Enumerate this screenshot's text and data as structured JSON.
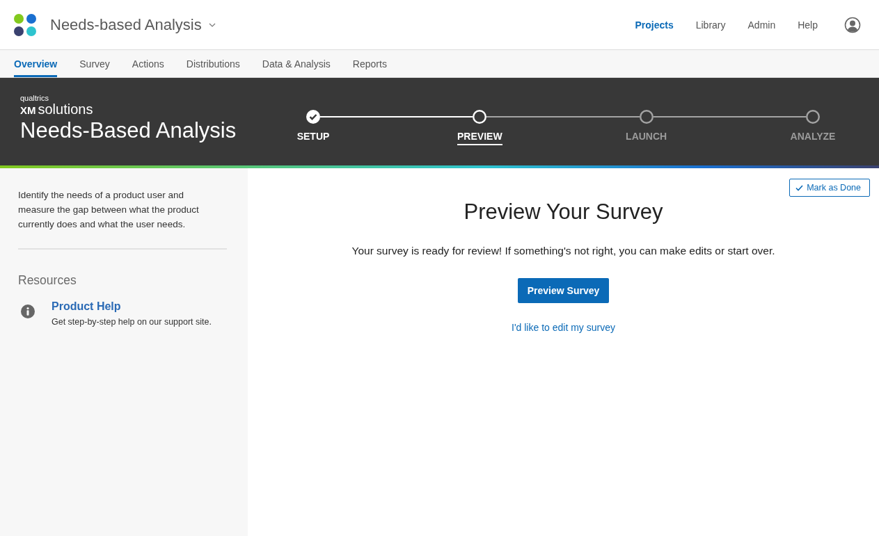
{
  "header": {
    "project_title": "Needs-based Analysis",
    "nav": [
      {
        "label": "Projects",
        "selected": true
      },
      {
        "label": "Library",
        "selected": false
      },
      {
        "label": "Admin",
        "selected": false
      },
      {
        "label": "Help",
        "selected": false
      }
    ]
  },
  "tabs": [
    {
      "label": "Overview",
      "selected": true
    },
    {
      "label": "Survey",
      "selected": false
    },
    {
      "label": "Actions",
      "selected": false
    },
    {
      "label": "Distributions",
      "selected": false
    },
    {
      "label": "Data & Analysis",
      "selected": false
    },
    {
      "label": "Reports",
      "selected": false
    }
  ],
  "banner": {
    "brand_small": "qualtrics",
    "brand_xm": "XM",
    "brand_solutions": "solutions",
    "title": "Needs-Based Analysis",
    "steps": [
      {
        "label": "SETUP",
        "completed": true,
        "reached": true,
        "selected": false
      },
      {
        "label": "PREVIEW",
        "completed": false,
        "reached": true,
        "selected": true
      },
      {
        "label": "LAUNCH",
        "completed": false,
        "reached": false,
        "selected": false
      },
      {
        "label": "ANALYZE",
        "completed": false,
        "reached": false,
        "selected": false
      }
    ]
  },
  "sidebar": {
    "description": "Identify the needs of a product user and measure the gap between what the product currently does and what the user needs.",
    "resources_heading": "Resources",
    "resources": [
      {
        "title": "Product Help",
        "description": "Get step-by-step help on our support site."
      }
    ]
  },
  "main": {
    "mark_done": "Mark as Done",
    "heading": "Preview Your Survey",
    "message": "Your survey is ready for review! If something's not right, you can make edits or start over.",
    "primary_button": "Preview Survey",
    "edit_link": "I'd like to edit my survey"
  }
}
